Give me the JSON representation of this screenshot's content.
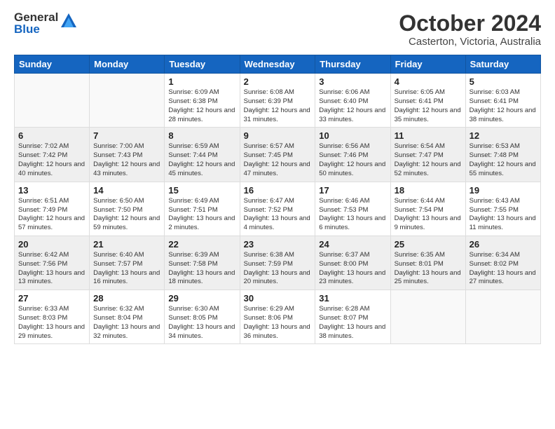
{
  "header": {
    "logo_general": "General",
    "logo_blue": "Blue",
    "month_title": "October 2024",
    "subtitle": "Casterton, Victoria, Australia"
  },
  "days_of_week": [
    "Sunday",
    "Monday",
    "Tuesday",
    "Wednesday",
    "Thursday",
    "Friday",
    "Saturday"
  ],
  "weeks": [
    [
      {
        "day": "",
        "info": ""
      },
      {
        "day": "",
        "info": ""
      },
      {
        "day": "1",
        "info": "Sunrise: 6:09 AM\nSunset: 6:38 PM\nDaylight: 12 hours and 28 minutes."
      },
      {
        "day": "2",
        "info": "Sunrise: 6:08 AM\nSunset: 6:39 PM\nDaylight: 12 hours and 31 minutes."
      },
      {
        "day": "3",
        "info": "Sunrise: 6:06 AM\nSunset: 6:40 PM\nDaylight: 12 hours and 33 minutes."
      },
      {
        "day": "4",
        "info": "Sunrise: 6:05 AM\nSunset: 6:41 PM\nDaylight: 12 hours and 35 minutes."
      },
      {
        "day": "5",
        "info": "Sunrise: 6:03 AM\nSunset: 6:41 PM\nDaylight: 12 hours and 38 minutes."
      }
    ],
    [
      {
        "day": "6",
        "info": "Sunrise: 7:02 AM\nSunset: 7:42 PM\nDaylight: 12 hours and 40 minutes."
      },
      {
        "day": "7",
        "info": "Sunrise: 7:00 AM\nSunset: 7:43 PM\nDaylight: 12 hours and 43 minutes."
      },
      {
        "day": "8",
        "info": "Sunrise: 6:59 AM\nSunset: 7:44 PM\nDaylight: 12 hours and 45 minutes."
      },
      {
        "day": "9",
        "info": "Sunrise: 6:57 AM\nSunset: 7:45 PM\nDaylight: 12 hours and 47 minutes."
      },
      {
        "day": "10",
        "info": "Sunrise: 6:56 AM\nSunset: 7:46 PM\nDaylight: 12 hours and 50 minutes."
      },
      {
        "day": "11",
        "info": "Sunrise: 6:54 AM\nSunset: 7:47 PM\nDaylight: 12 hours and 52 minutes."
      },
      {
        "day": "12",
        "info": "Sunrise: 6:53 AM\nSunset: 7:48 PM\nDaylight: 12 hours and 55 minutes."
      }
    ],
    [
      {
        "day": "13",
        "info": "Sunrise: 6:51 AM\nSunset: 7:49 PM\nDaylight: 12 hours and 57 minutes."
      },
      {
        "day": "14",
        "info": "Sunrise: 6:50 AM\nSunset: 7:50 PM\nDaylight: 12 hours and 59 minutes."
      },
      {
        "day": "15",
        "info": "Sunrise: 6:49 AM\nSunset: 7:51 PM\nDaylight: 13 hours and 2 minutes."
      },
      {
        "day": "16",
        "info": "Sunrise: 6:47 AM\nSunset: 7:52 PM\nDaylight: 13 hours and 4 minutes."
      },
      {
        "day": "17",
        "info": "Sunrise: 6:46 AM\nSunset: 7:53 PM\nDaylight: 13 hours and 6 minutes."
      },
      {
        "day": "18",
        "info": "Sunrise: 6:44 AM\nSunset: 7:54 PM\nDaylight: 13 hours and 9 minutes."
      },
      {
        "day": "19",
        "info": "Sunrise: 6:43 AM\nSunset: 7:55 PM\nDaylight: 13 hours and 11 minutes."
      }
    ],
    [
      {
        "day": "20",
        "info": "Sunrise: 6:42 AM\nSunset: 7:56 PM\nDaylight: 13 hours and 13 minutes."
      },
      {
        "day": "21",
        "info": "Sunrise: 6:40 AM\nSunset: 7:57 PM\nDaylight: 13 hours and 16 minutes."
      },
      {
        "day": "22",
        "info": "Sunrise: 6:39 AM\nSunset: 7:58 PM\nDaylight: 13 hours and 18 minutes."
      },
      {
        "day": "23",
        "info": "Sunrise: 6:38 AM\nSunset: 7:59 PM\nDaylight: 13 hours and 20 minutes."
      },
      {
        "day": "24",
        "info": "Sunrise: 6:37 AM\nSunset: 8:00 PM\nDaylight: 13 hours and 23 minutes."
      },
      {
        "day": "25",
        "info": "Sunrise: 6:35 AM\nSunset: 8:01 PM\nDaylight: 13 hours and 25 minutes."
      },
      {
        "day": "26",
        "info": "Sunrise: 6:34 AM\nSunset: 8:02 PM\nDaylight: 13 hours and 27 minutes."
      }
    ],
    [
      {
        "day": "27",
        "info": "Sunrise: 6:33 AM\nSunset: 8:03 PM\nDaylight: 13 hours and 29 minutes."
      },
      {
        "day": "28",
        "info": "Sunrise: 6:32 AM\nSunset: 8:04 PM\nDaylight: 13 hours and 32 minutes."
      },
      {
        "day": "29",
        "info": "Sunrise: 6:30 AM\nSunset: 8:05 PM\nDaylight: 13 hours and 34 minutes."
      },
      {
        "day": "30",
        "info": "Sunrise: 6:29 AM\nSunset: 8:06 PM\nDaylight: 13 hours and 36 minutes."
      },
      {
        "day": "31",
        "info": "Sunrise: 6:28 AM\nSunset: 8:07 PM\nDaylight: 13 hours and 38 minutes."
      },
      {
        "day": "",
        "info": ""
      },
      {
        "day": "",
        "info": ""
      }
    ]
  ]
}
